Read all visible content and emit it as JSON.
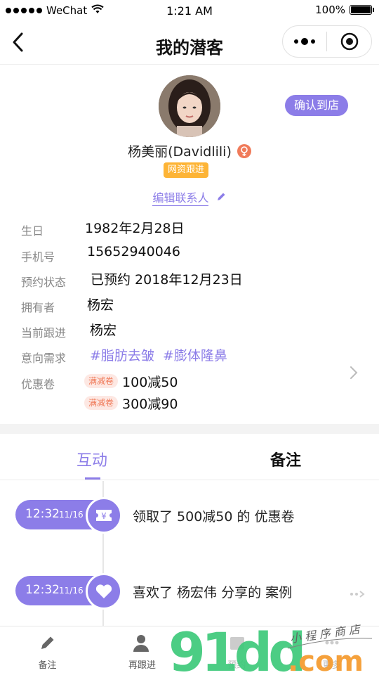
{
  "status_bar": {
    "carrier": "WeChat",
    "time": "1:21 AM",
    "battery": "100%",
    "battery_level": 1.0
  },
  "nav": {
    "title": "我的潜客"
  },
  "profile": {
    "confirm_button": "确认到店",
    "name": "杨美丽(Davidlili)",
    "status_tag": "网资跟进",
    "edit_link": "编辑联系人",
    "fields": [
      {
        "label": "生日",
        "value": "1982年2月28日"
      },
      {
        "label": "手机号",
        "value": "15652940046"
      },
      {
        "label": "预约状态",
        "value": "已预约 2018年12月23日"
      },
      {
        "label": "拥有者",
        "value": "杨宏"
      },
      {
        "label": "当前跟进",
        "value": "杨宏"
      },
      {
        "label": "意向需求",
        "value": "#脂肪去皱  #膨体隆鼻"
      },
      {
        "label": "优惠卷",
        "value": ""
      }
    ],
    "coupons": [
      {
        "tag": "满减卷",
        "text": "100减50"
      },
      {
        "tag": "满减卷",
        "text": "300减90"
      }
    ]
  },
  "tabs": [
    {
      "label": "互动",
      "active": true
    },
    {
      "label": "备注",
      "active": false
    }
  ],
  "timeline": [
    {
      "time": "12:32",
      "date": "11/16",
      "icon": "coupon-icon",
      "text": "领取了 500减50 的 优惠卷"
    },
    {
      "time": "12:32",
      "date": "11/16",
      "icon": "heart-icon",
      "text": "喜欢了 杨宏伟 分享的 案例"
    }
  ],
  "bottom_bar": [
    {
      "label": "备注",
      "icon": "pencil-icon"
    },
    {
      "label": "再跟进",
      "icon": "user-transfer-icon"
    },
    {
      "label": "预约",
      "icon": "calendar-icon"
    },
    {
      "label": "更多",
      "icon": "more-icon"
    }
  ],
  "watermark": {
    "brand": "91dd.com",
    "caption": "小程序商店"
  },
  "colors": {
    "accent": "#8c7de8",
    "orange_tag": "#fdb436",
    "coupon_tag_bg": "#fde8e3",
    "coupon_tag_text": "#f07b5a",
    "watermark_green": "#3dc97a",
    "watermark_orange": "#f59a2c"
  }
}
